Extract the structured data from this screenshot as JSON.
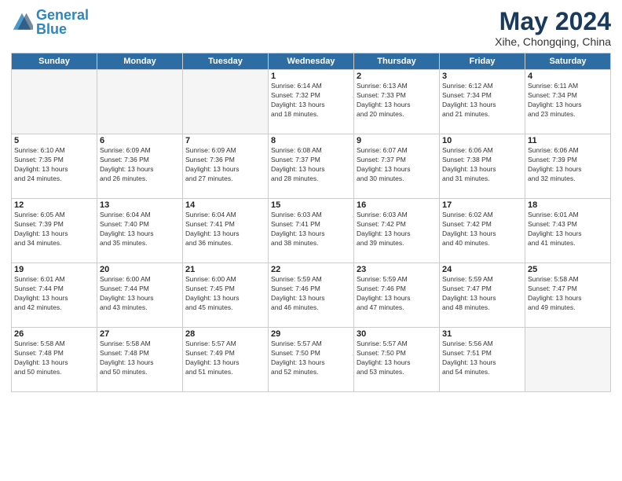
{
  "header": {
    "logo_general": "General",
    "logo_blue": "Blue",
    "month_title": "May 2024",
    "location": "Xihe, Chongqing, China"
  },
  "weekdays": [
    "Sunday",
    "Monday",
    "Tuesday",
    "Wednesday",
    "Thursday",
    "Friday",
    "Saturday"
  ],
  "weeks": [
    [
      {
        "day": "",
        "info": ""
      },
      {
        "day": "",
        "info": ""
      },
      {
        "day": "",
        "info": ""
      },
      {
        "day": "1",
        "info": "Sunrise: 6:14 AM\nSunset: 7:32 PM\nDaylight: 13 hours\nand 18 minutes."
      },
      {
        "day": "2",
        "info": "Sunrise: 6:13 AM\nSunset: 7:33 PM\nDaylight: 13 hours\nand 20 minutes."
      },
      {
        "day": "3",
        "info": "Sunrise: 6:12 AM\nSunset: 7:34 PM\nDaylight: 13 hours\nand 21 minutes."
      },
      {
        "day": "4",
        "info": "Sunrise: 6:11 AM\nSunset: 7:34 PM\nDaylight: 13 hours\nand 23 minutes."
      }
    ],
    [
      {
        "day": "5",
        "info": "Sunrise: 6:10 AM\nSunset: 7:35 PM\nDaylight: 13 hours\nand 24 minutes."
      },
      {
        "day": "6",
        "info": "Sunrise: 6:09 AM\nSunset: 7:36 PM\nDaylight: 13 hours\nand 26 minutes."
      },
      {
        "day": "7",
        "info": "Sunrise: 6:09 AM\nSunset: 7:36 PM\nDaylight: 13 hours\nand 27 minutes."
      },
      {
        "day": "8",
        "info": "Sunrise: 6:08 AM\nSunset: 7:37 PM\nDaylight: 13 hours\nand 28 minutes."
      },
      {
        "day": "9",
        "info": "Sunrise: 6:07 AM\nSunset: 7:37 PM\nDaylight: 13 hours\nand 30 minutes."
      },
      {
        "day": "10",
        "info": "Sunrise: 6:06 AM\nSunset: 7:38 PM\nDaylight: 13 hours\nand 31 minutes."
      },
      {
        "day": "11",
        "info": "Sunrise: 6:06 AM\nSunset: 7:39 PM\nDaylight: 13 hours\nand 32 minutes."
      }
    ],
    [
      {
        "day": "12",
        "info": "Sunrise: 6:05 AM\nSunset: 7:39 PM\nDaylight: 13 hours\nand 34 minutes."
      },
      {
        "day": "13",
        "info": "Sunrise: 6:04 AM\nSunset: 7:40 PM\nDaylight: 13 hours\nand 35 minutes."
      },
      {
        "day": "14",
        "info": "Sunrise: 6:04 AM\nSunset: 7:41 PM\nDaylight: 13 hours\nand 36 minutes."
      },
      {
        "day": "15",
        "info": "Sunrise: 6:03 AM\nSunset: 7:41 PM\nDaylight: 13 hours\nand 38 minutes."
      },
      {
        "day": "16",
        "info": "Sunrise: 6:03 AM\nSunset: 7:42 PM\nDaylight: 13 hours\nand 39 minutes."
      },
      {
        "day": "17",
        "info": "Sunrise: 6:02 AM\nSunset: 7:42 PM\nDaylight: 13 hours\nand 40 minutes."
      },
      {
        "day": "18",
        "info": "Sunrise: 6:01 AM\nSunset: 7:43 PM\nDaylight: 13 hours\nand 41 minutes."
      }
    ],
    [
      {
        "day": "19",
        "info": "Sunrise: 6:01 AM\nSunset: 7:44 PM\nDaylight: 13 hours\nand 42 minutes."
      },
      {
        "day": "20",
        "info": "Sunrise: 6:00 AM\nSunset: 7:44 PM\nDaylight: 13 hours\nand 43 minutes."
      },
      {
        "day": "21",
        "info": "Sunrise: 6:00 AM\nSunset: 7:45 PM\nDaylight: 13 hours\nand 45 minutes."
      },
      {
        "day": "22",
        "info": "Sunrise: 5:59 AM\nSunset: 7:46 PM\nDaylight: 13 hours\nand 46 minutes."
      },
      {
        "day": "23",
        "info": "Sunrise: 5:59 AM\nSunset: 7:46 PM\nDaylight: 13 hours\nand 47 minutes."
      },
      {
        "day": "24",
        "info": "Sunrise: 5:59 AM\nSunset: 7:47 PM\nDaylight: 13 hours\nand 48 minutes."
      },
      {
        "day": "25",
        "info": "Sunrise: 5:58 AM\nSunset: 7:47 PM\nDaylight: 13 hours\nand 49 minutes."
      }
    ],
    [
      {
        "day": "26",
        "info": "Sunrise: 5:58 AM\nSunset: 7:48 PM\nDaylight: 13 hours\nand 50 minutes."
      },
      {
        "day": "27",
        "info": "Sunrise: 5:58 AM\nSunset: 7:48 PM\nDaylight: 13 hours\nand 50 minutes."
      },
      {
        "day": "28",
        "info": "Sunrise: 5:57 AM\nSunset: 7:49 PM\nDaylight: 13 hours\nand 51 minutes."
      },
      {
        "day": "29",
        "info": "Sunrise: 5:57 AM\nSunset: 7:50 PM\nDaylight: 13 hours\nand 52 minutes."
      },
      {
        "day": "30",
        "info": "Sunrise: 5:57 AM\nSunset: 7:50 PM\nDaylight: 13 hours\nand 53 minutes."
      },
      {
        "day": "31",
        "info": "Sunrise: 5:56 AM\nSunset: 7:51 PM\nDaylight: 13 hours\nand 54 minutes."
      },
      {
        "day": "",
        "info": ""
      }
    ]
  ]
}
